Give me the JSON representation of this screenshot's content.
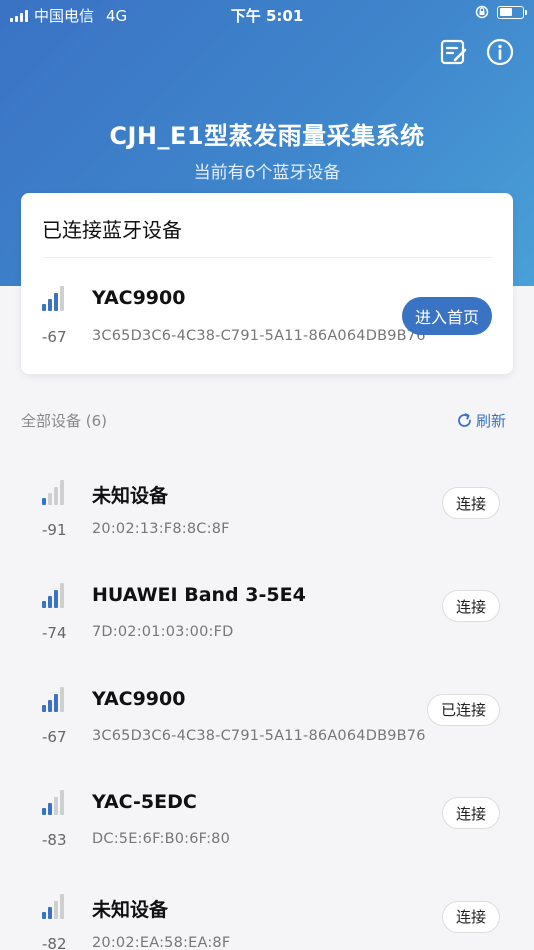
{
  "status_bar": {
    "carrier": "中国电信",
    "network": "4G",
    "time": "下午 5:01"
  },
  "header": {
    "title": "CJH_E1型蒸发雨量采集系统",
    "subtitle": "当前有6个蓝牙设备",
    "icons": [
      "edit-note-icon",
      "info-icon"
    ]
  },
  "connected_section": {
    "title": "已连接蓝牙设备",
    "device": {
      "name": "YAC9900",
      "rssi": "-67",
      "id": "3C65D3C6-4C38-C791-5A11-86A064DB9B76",
      "signal_level": 3
    },
    "enter_label": "进入首页"
  },
  "list_header": {
    "label": "全部设备 (6)",
    "refresh_label": "刷新"
  },
  "devices": [
    {
      "name": "未知设备",
      "rssi": "-91",
      "id": "20:02:13:F8:8C:8F",
      "button": "连接",
      "signal_level": 1
    },
    {
      "name": "HUAWEI Band 3-5E4",
      "rssi": "-74",
      "id": "7D:02:01:03:00:FD",
      "button": "连接",
      "signal_level": 3
    },
    {
      "name": "YAC9900",
      "rssi": "-67",
      "id": "3C65D3C6-4C38-C791-5A11-86A064DB9B76",
      "button": "已连接",
      "signal_level": 3
    },
    {
      "name": "YAC-5EDC",
      "rssi": "-83",
      "id": "DC:5E:6F:B0:6F:80",
      "button": "连接",
      "signal_level": 2
    },
    {
      "name": "未知设备",
      "rssi": "-82",
      "id": "20:02:EA:58:EA:8F",
      "button": "连接",
      "signal_level": 2
    }
  ],
  "colors": {
    "accent": "#3a72c4",
    "signal_active": "#3a72c4",
    "signal_inactive": "#cfcfcf"
  }
}
